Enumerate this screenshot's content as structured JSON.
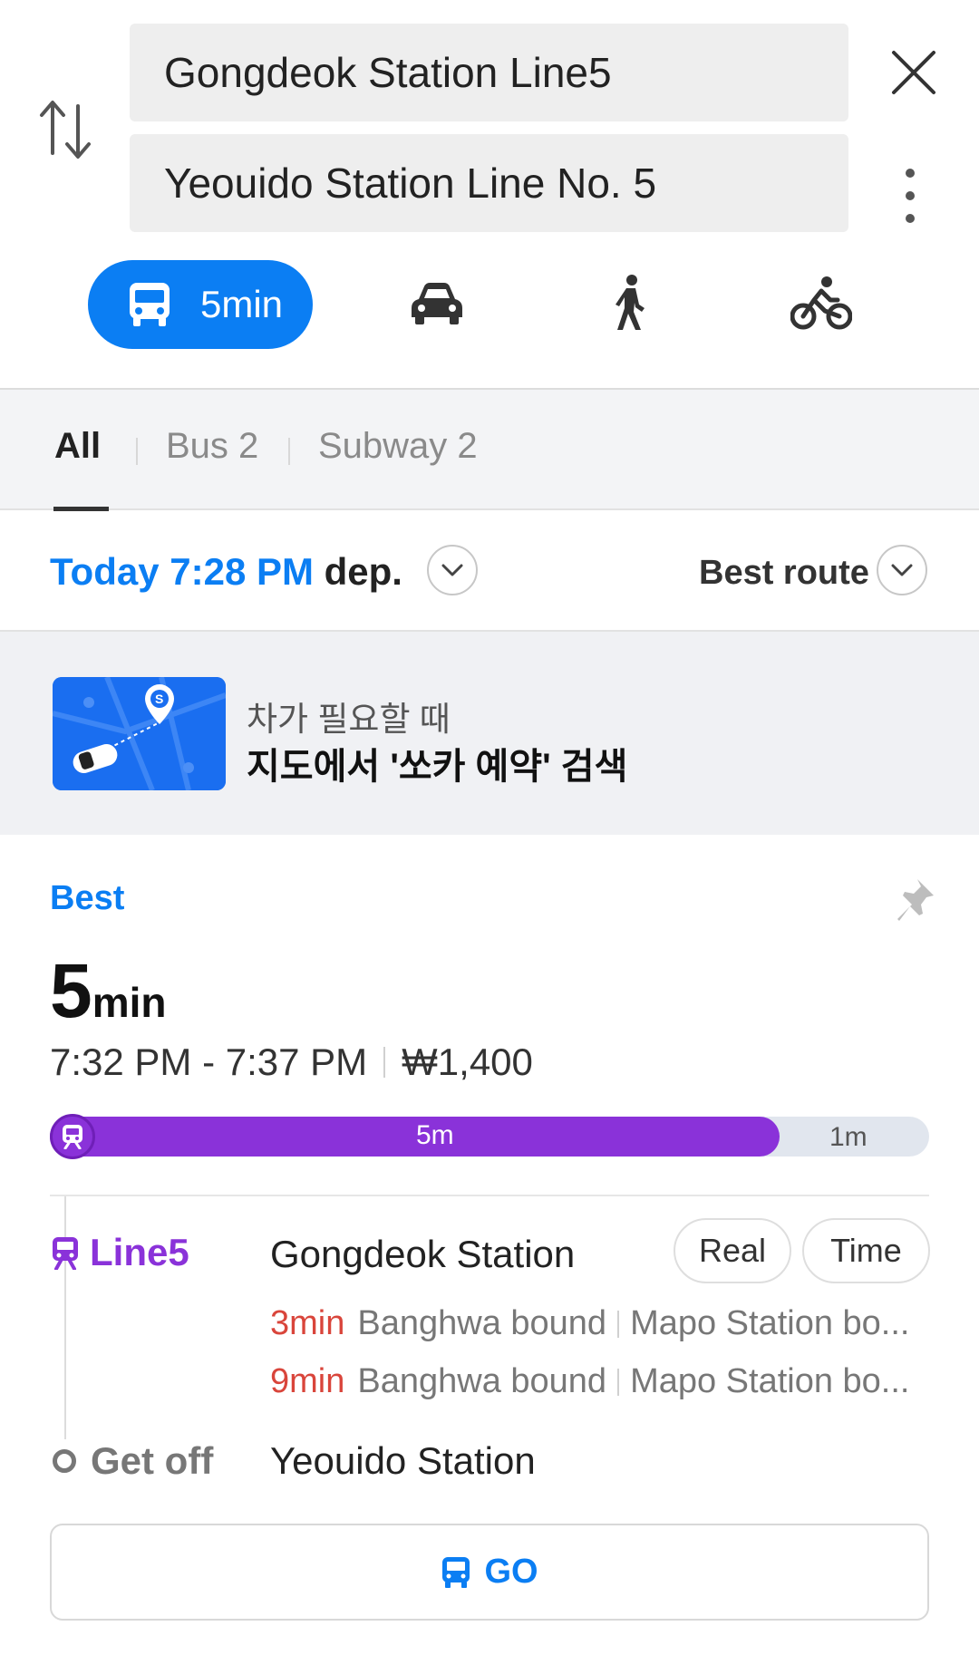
{
  "search": {
    "from": "Gongdeok Station Line5",
    "to": "Yeouido Station Line No. 5"
  },
  "modes": {
    "transit_label": "5min",
    "selected": "transit",
    "icons": [
      "bus-icon",
      "car-icon",
      "walk-icon",
      "bike-icon"
    ]
  },
  "tabs": {
    "all": "All",
    "bus": "Bus 2",
    "subway": "Subway 2",
    "active": "All"
  },
  "departure": {
    "when": "Today 7:28 PM",
    "suffix": "dep.",
    "sort": "Best route"
  },
  "ad": {
    "line1": "차가 필요할 때",
    "line2": "지도에서 '쏘카 예약' 검색"
  },
  "route": {
    "badge": "Best",
    "duration_num": "5",
    "duration_unit": "min",
    "time_range": "7:32 PM - 7:37 PM",
    "fare": "₩1,400",
    "segments": {
      "ride_label": "5m",
      "walk_label": "1m",
      "ride_fraction": 0.83
    },
    "line_name": "Line5",
    "board_station": "Gongdeok Station",
    "realtime_left": "Real",
    "realtime_right": "Time",
    "arrivals": [
      {
        "mins": "3min",
        "dir1": "Banghwa bound",
        "dir2": "Mapo Station bo..."
      },
      {
        "mins": "9min",
        "dir1": "Banghwa bound",
        "dir2": "Mapo Station bo..."
      }
    ],
    "getoff_label": "Get off",
    "alight_station": "Yeouido Station",
    "go_label": "GO"
  },
  "colors": {
    "accent": "#0b7ef3",
    "line5": "#8a32d9",
    "arrival_time": "#d9453b"
  }
}
